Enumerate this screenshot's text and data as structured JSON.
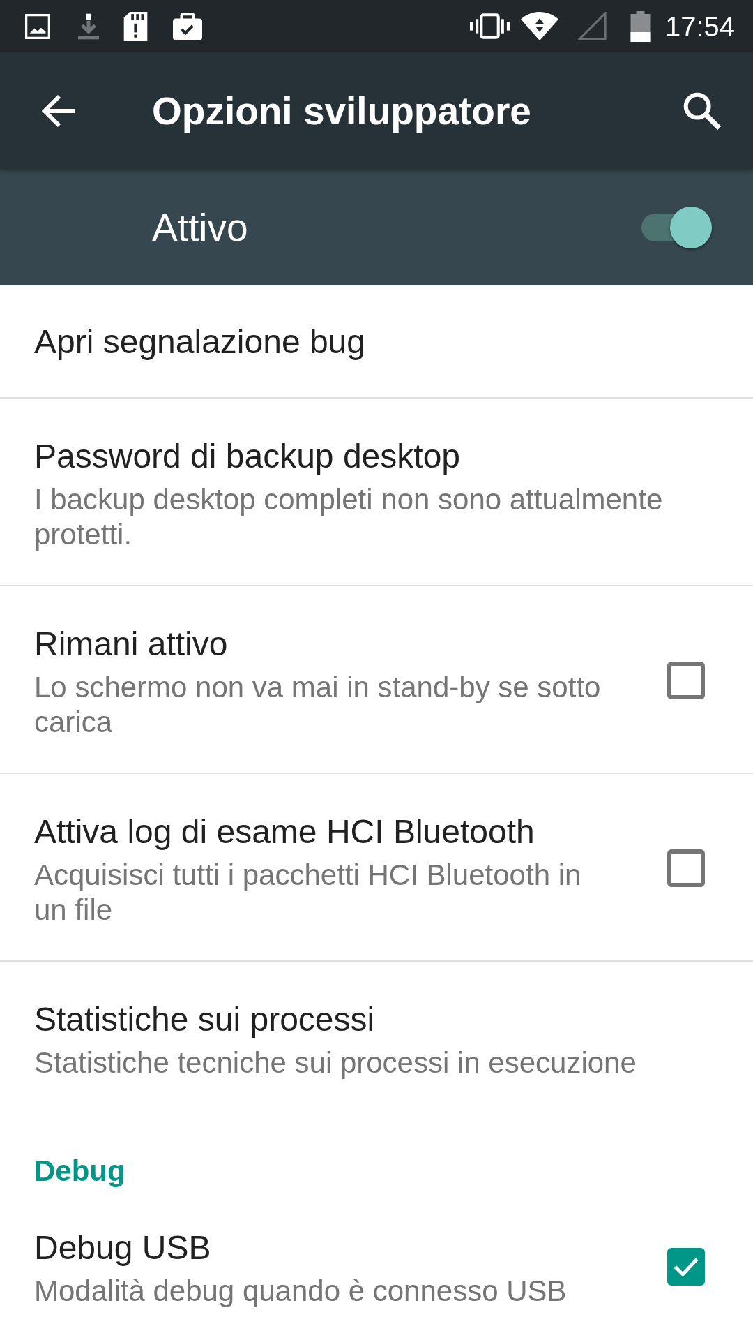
{
  "status_bar": {
    "time": "17:54"
  },
  "toolbar": {
    "title": "Opzioni sviluppatore"
  },
  "master_switch": {
    "label": "Attivo",
    "on": true
  },
  "sections": [
    {
      "items": [
        {
          "kind": "plain",
          "title": "Apri segnalazione bug"
        },
        {
          "kind": "plain",
          "title": "Password di backup desktop",
          "summary": "I backup desktop completi non sono attualmente protetti."
        },
        {
          "kind": "checkbox",
          "title": "Rimani attivo",
          "summary": "Lo schermo non va mai in stand-by se sotto carica",
          "checked": false
        },
        {
          "kind": "checkbox",
          "title": "Attiva log di esame HCI Bluetooth",
          "summary": "Acquisisci tutti i pacchetti HCI Bluetooth in un file",
          "checked": false
        },
        {
          "kind": "plain",
          "title": "Statistiche sui processi",
          "summary": "Statistiche tecniche sui processi in esecuzione"
        }
      ]
    },
    {
      "title": "Debug",
      "items": [
        {
          "kind": "checkbox",
          "title": "Debug USB",
          "summary": "Modalità debug quando è connesso USB",
          "checked": true
        }
      ]
    }
  ]
}
